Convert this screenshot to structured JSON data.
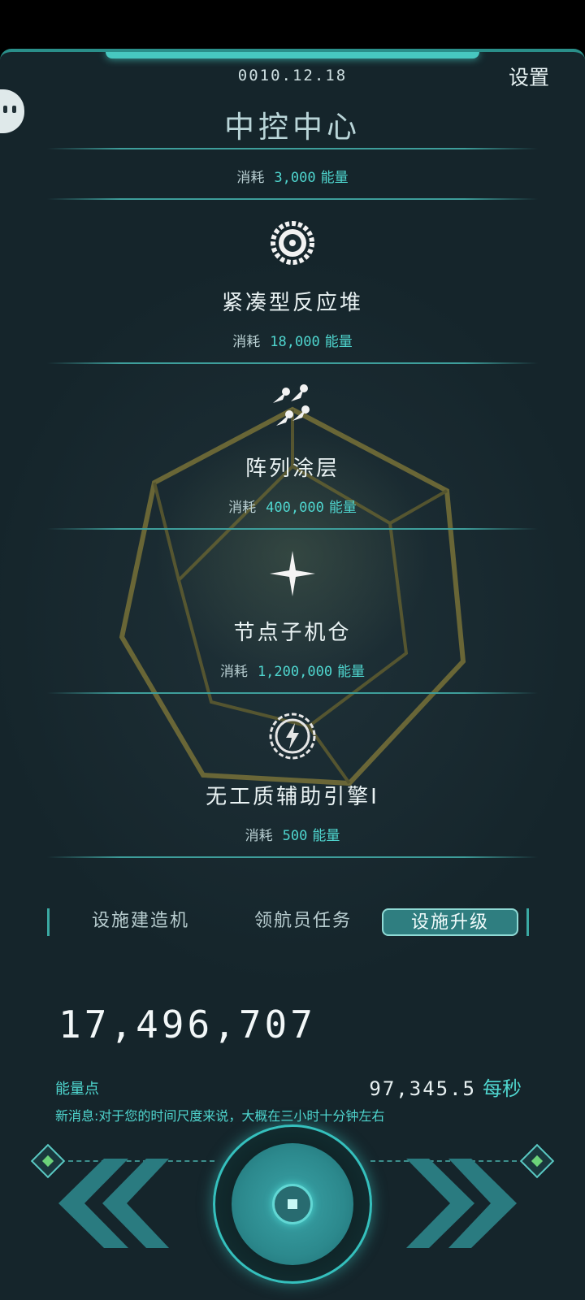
{
  "header": {
    "date": "0010.12.18",
    "settings_label": "设置",
    "title": "中控中心"
  },
  "cost_label": "消耗",
  "energy_unit": "能量",
  "first_cost": "3,000",
  "facilities": [
    {
      "icon": "gear-reactor-icon",
      "name": "紧凑型反应堆",
      "cost": "18,000"
    },
    {
      "icon": "array-coating-icon",
      "name": "阵列涂层",
      "cost": "400,000"
    },
    {
      "icon": "sparkle-star-icon",
      "name": "节点子机仓",
      "cost": "1,200,000"
    },
    {
      "icon": "lightning-gear-icon",
      "name": "无工质辅助引擎I",
      "cost": "500"
    }
  ],
  "tabs": [
    {
      "label": "设施建造机",
      "active": false
    },
    {
      "label": "领航员任务",
      "active": false
    },
    {
      "label": "设施升级",
      "active": true
    }
  ],
  "energy": {
    "points": "17,496,707",
    "points_label": "能量点",
    "rate": "97,345.5",
    "rate_unit": "每秒"
  },
  "message": "新消息:对于您的时间尺度来说，大概在三小时十分钟左右",
  "colors": {
    "accent": "#4fd6cf",
    "background": "#1a2c32",
    "active_tab": "#2f7e80"
  }
}
